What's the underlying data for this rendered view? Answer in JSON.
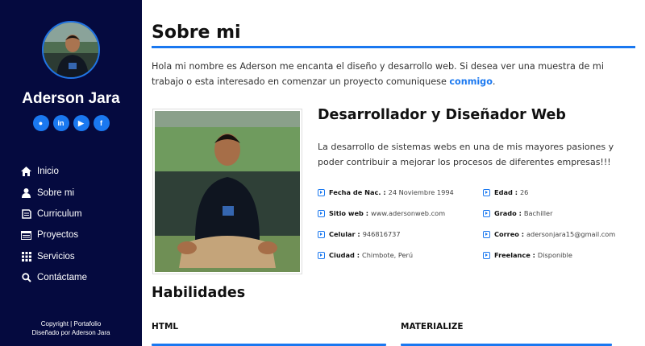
{
  "profile": {
    "name": "Aderson Jara"
  },
  "social": [
    {
      "icon": "github-icon",
      "glyph": "●"
    },
    {
      "icon": "linkedin-icon",
      "glyph": "in"
    },
    {
      "icon": "youtube-icon",
      "glyph": "▶"
    },
    {
      "icon": "facebook-icon",
      "glyph": "f"
    }
  ],
  "nav": {
    "items": [
      {
        "label": "Inicio",
        "icon": "home-icon"
      },
      {
        "label": "Sobre mi",
        "icon": "user-icon"
      },
      {
        "label": "Curriculum",
        "icon": "file-icon"
      },
      {
        "label": "Proyectos",
        "icon": "window-icon"
      },
      {
        "label": "Servicios",
        "icon": "grid-icon"
      },
      {
        "label": "Contáctame",
        "icon": "search-icon"
      }
    ]
  },
  "footer": {
    "line1": "Copyright | Portafolio",
    "line2": "Diseñado por Aderson Jara"
  },
  "about": {
    "title": "Sobre mi",
    "intro": "Hola mi nombre es Aderson me encanta el diseño y desarrollo web. Si desea ver una muestra de mi trabajo o esta interesado en comenzar un proyecto comuniquese",
    "intro_link": "conmigo",
    "intro_end": ".",
    "role": "Desarrollador y Diseñador Web",
    "role_desc": "La desarrollo de sistemas webs en una de mis mayores pasiones y poder contribuir a mejorar los procesos de diferentes empresas!!!",
    "facts": [
      {
        "label": "Fecha de Nac. :",
        "value": "24 Noviembre 1994"
      },
      {
        "label": "Sitio web :",
        "value": "www.adersonweb.com"
      },
      {
        "label": "Celular :",
        "value": "946816737"
      },
      {
        "label": "Ciudad :",
        "value": "Chimbote, Perú"
      },
      {
        "label": "Edad :",
        "value": "26"
      },
      {
        "label": "Grado :",
        "value": "Bachiller"
      },
      {
        "label": "Correo :",
        "value": "adersonjara15@gmail.com"
      },
      {
        "label": "Freelance :",
        "value": "Disponible"
      }
    ]
  },
  "skills": {
    "title": "Habilidades",
    "items": [
      {
        "name": "HTML"
      },
      {
        "name": "MATERIALIZE"
      }
    ]
  },
  "colors": {
    "sidebar": "#050a3f",
    "accent": "#1a78f0"
  }
}
